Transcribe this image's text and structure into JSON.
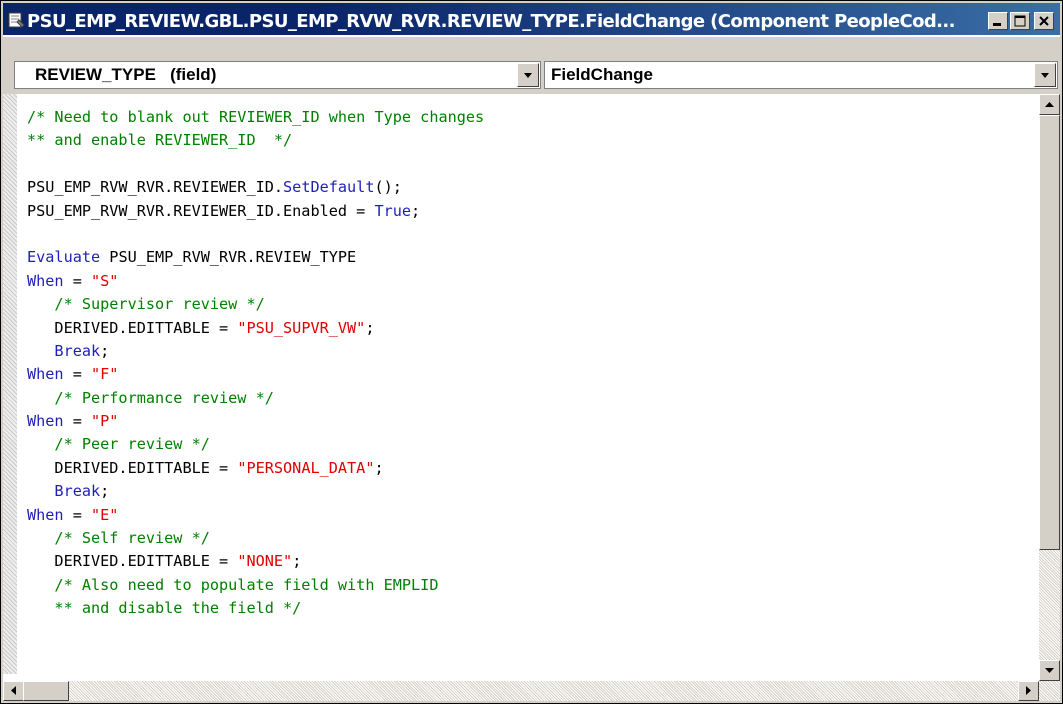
{
  "window": {
    "title": "PSU_EMP_REVIEW.GBL.PSU_EMP_RVW_RVR.REVIEW_TYPE.FieldChange (Component PeopleCod..."
  },
  "toolbar": {
    "field_select": "REVIEW_TYPE   (field)",
    "event_select": "FieldChange"
  },
  "colors": {
    "comment": "#008000",
    "keyword": "#1f1fb8",
    "string": "#e00000",
    "title_bar": "#0a246a"
  },
  "code": {
    "lines": [
      [
        {
          "t": "/* Need to blank out REVIEWER_ID when Type changes",
          "c": "c"
        }
      ],
      [
        {
          "t": "** and enable REVIEWER_ID  */",
          "c": "c"
        }
      ],
      [
        {
          "t": " ",
          "c": "t"
        }
      ],
      [
        {
          "t": "PSU_EMP_RVW_RVR.REVIEWER_ID.",
          "c": "t"
        },
        {
          "t": "SetDefault",
          "c": "k"
        },
        {
          "t": "();",
          "c": "t"
        }
      ],
      [
        {
          "t": "PSU_EMP_RVW_RVR.REVIEWER_ID.Enabled = ",
          "c": "t"
        },
        {
          "t": "True",
          "c": "k"
        },
        {
          "t": ";",
          "c": "t"
        }
      ],
      [
        {
          "t": " ",
          "c": "t"
        }
      ],
      [
        {
          "t": "Evaluate",
          "c": "k"
        },
        {
          "t": " PSU_EMP_RVW_RVR.REVIEW_TYPE",
          "c": "t"
        }
      ],
      [
        {
          "t": "When",
          "c": "k"
        },
        {
          "t": " = ",
          "c": "t"
        },
        {
          "t": "\"S\"",
          "c": "s"
        }
      ],
      [
        {
          "t": "   /* Supervisor review */",
          "c": "c"
        }
      ],
      [
        {
          "t": "   DERIVED.EDITTABLE = ",
          "c": "t"
        },
        {
          "t": "\"PSU_SUPVR_VW\"",
          "c": "s"
        },
        {
          "t": ";",
          "c": "t"
        }
      ],
      [
        {
          "t": "   Break",
          "c": "k"
        },
        {
          "t": ";",
          "c": "t"
        }
      ],
      [
        {
          "t": "When",
          "c": "k"
        },
        {
          "t": " = ",
          "c": "t"
        },
        {
          "t": "\"F\"",
          "c": "s"
        }
      ],
      [
        {
          "t": "   /* Performance review */",
          "c": "c"
        }
      ],
      [
        {
          "t": "When",
          "c": "k"
        },
        {
          "t": " = ",
          "c": "t"
        },
        {
          "t": "\"P\"",
          "c": "s"
        }
      ],
      [
        {
          "t": "   /* Peer review */",
          "c": "c"
        }
      ],
      [
        {
          "t": "   DERIVED.EDITTABLE = ",
          "c": "t"
        },
        {
          "t": "\"PERSONAL_DATA\"",
          "c": "s"
        },
        {
          "t": ";",
          "c": "t"
        }
      ],
      [
        {
          "t": "   Break",
          "c": "k"
        },
        {
          "t": ";",
          "c": "t"
        }
      ],
      [
        {
          "t": "When",
          "c": "k"
        },
        {
          "t": " = ",
          "c": "t"
        },
        {
          "t": "\"E\"",
          "c": "s"
        }
      ],
      [
        {
          "t": "   /* Self review */",
          "c": "c"
        }
      ],
      [
        {
          "t": "   DERIVED.EDITTABLE = ",
          "c": "t"
        },
        {
          "t": "\"NONE\"",
          "c": "s"
        },
        {
          "t": ";",
          "c": "t"
        }
      ],
      [
        {
          "t": "   /* Also need to populate field with EMPLID",
          "c": "c"
        }
      ],
      [
        {
          "t": "   ** and disable the field */",
          "c": "c"
        }
      ]
    ]
  }
}
